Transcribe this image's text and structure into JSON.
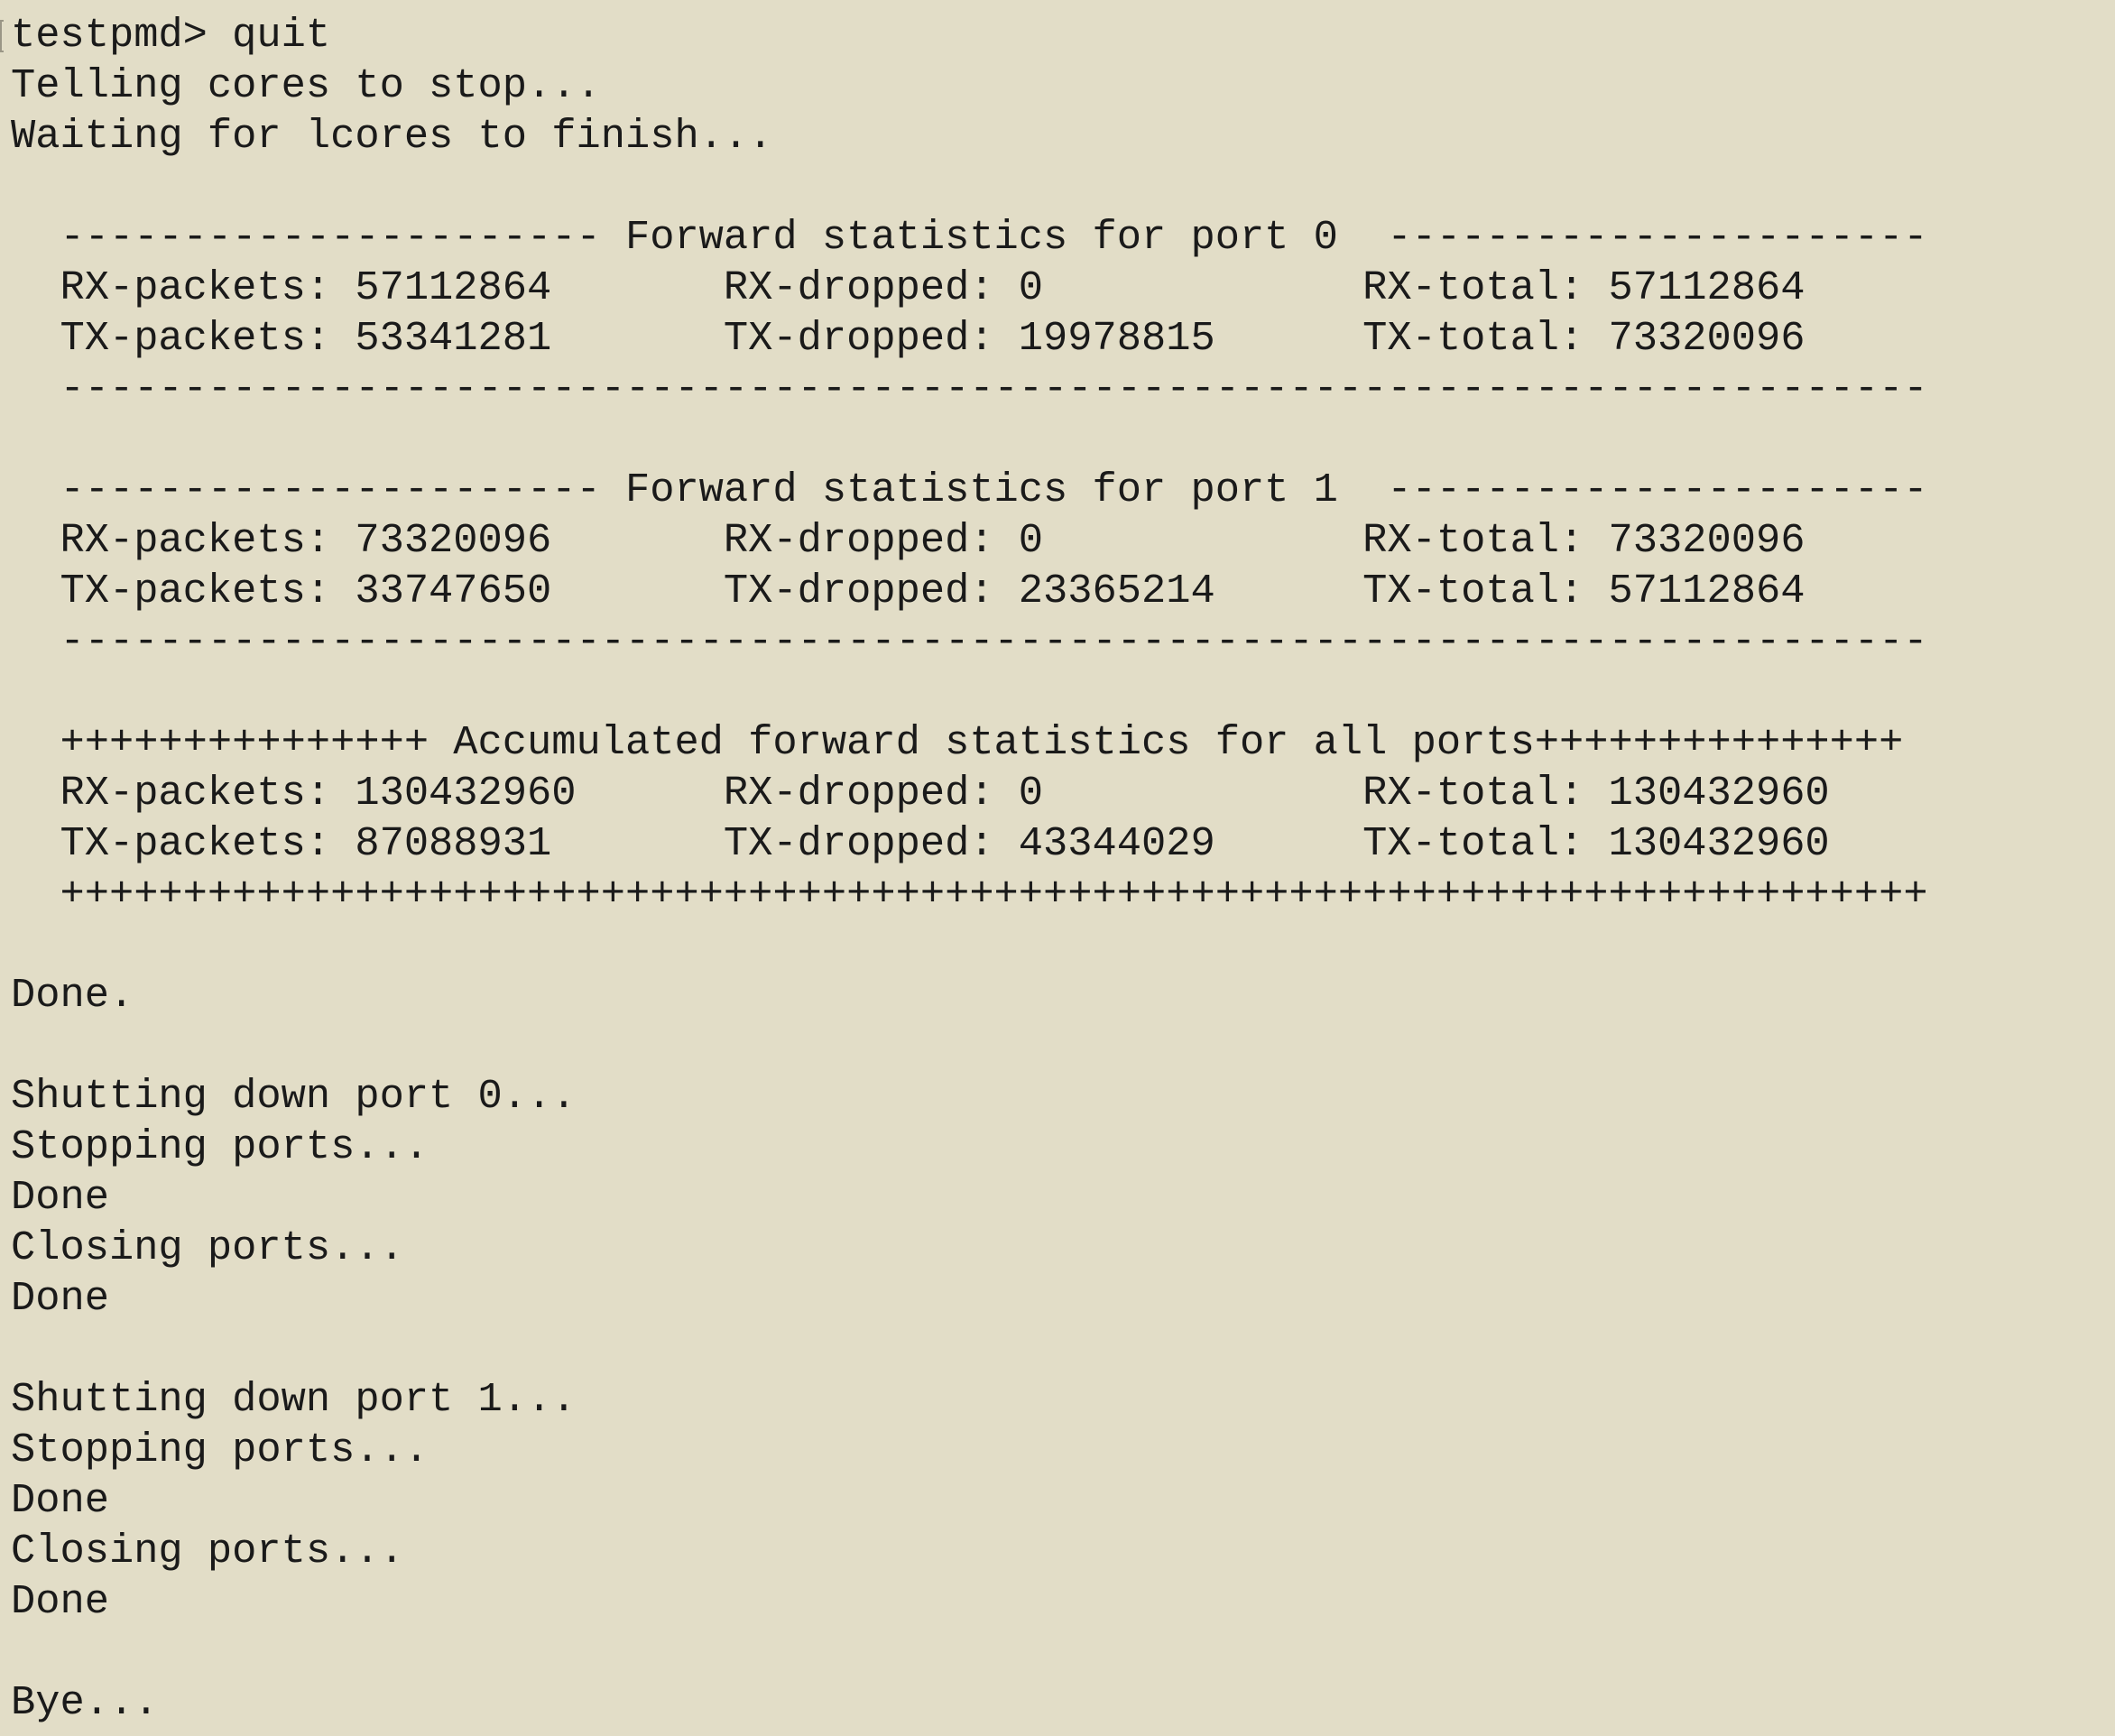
{
  "terminal": {
    "top_edge": "+++++++++++++++++++++++++++++++++++++++++++++++++++++++++++++++++++++++++",
    "lines": [
      "testpmd> quit",
      "Telling cores to stop...",
      "Waiting for lcores to finish...",
      "",
      "  ---------------------- Forward statistics for port 0  ----------------------",
      "  RX-packets: 57112864       RX-dropped: 0             RX-total: 57112864",
      "  TX-packets: 53341281       TX-dropped: 19978815      TX-total: 73320096",
      "  ----------------------------------------------------------------------------",
      "",
      "  ---------------------- Forward statistics for port 1  ----------------------",
      "  RX-packets: 73320096       RX-dropped: 0             RX-total: 73320096",
      "  TX-packets: 33747650       TX-dropped: 23365214      TX-total: 57112864",
      "  ----------------------------------------------------------------------------",
      "",
      "  +++++++++++++++ Accumulated forward statistics for all ports+++++++++++++++",
      "  RX-packets: 130432960      RX-dropped: 0             RX-total: 130432960",
      "  TX-packets: 87088931       TX-dropped: 43344029      TX-total: 130432960",
      "  ++++++++++++++++++++++++++++++++++++++++++++++++++++++++++++++++++++++++++++",
      "",
      "Done.",
      "",
      "Shutting down port 0...",
      "Stopping ports...",
      "Done",
      "Closing ports...",
      "Done",
      "",
      "Shutting down port 1...",
      "Stopping ports...",
      "Done",
      "Closing ports...",
      "Done",
      "",
      "Bye..."
    ]
  }
}
